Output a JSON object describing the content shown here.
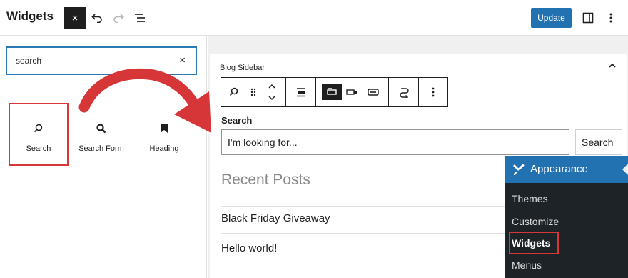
{
  "header": {
    "title": "Widgets",
    "close_icon": "×",
    "update_label": "Update",
    "icons": [
      "close-icon",
      "undo-icon",
      "redo-icon",
      "list-view-icon",
      "sidebar-toggle-icon",
      "more-vertical-icon"
    ]
  },
  "inserter": {
    "search_value": "search",
    "clear_icon": "×",
    "blocks": [
      {
        "label": "Search",
        "icon": "search-icon"
      },
      {
        "label": "Search Form",
        "icon": "search-form-icon"
      },
      {
        "label": "Heading",
        "icon": "bookmark-icon"
      }
    ]
  },
  "canvas": {
    "widget_area_title": "Blog Sidebar",
    "block_label": "Search",
    "input_placeholder": "I'm looking for...",
    "button_label": "Search",
    "recent_posts_heading": "Recent Posts",
    "posts": [
      "Black Friday Giveaway",
      "Hello world!"
    ]
  },
  "admin_menu": {
    "header": "Appearance",
    "items": [
      "Themes",
      "Customize",
      "Widgets",
      "Menus"
    ],
    "active": "Widgets"
  },
  "colors": {
    "accent": "#2271b1",
    "highlight_red": "#d63638",
    "admin_bg": "#1d2327"
  }
}
